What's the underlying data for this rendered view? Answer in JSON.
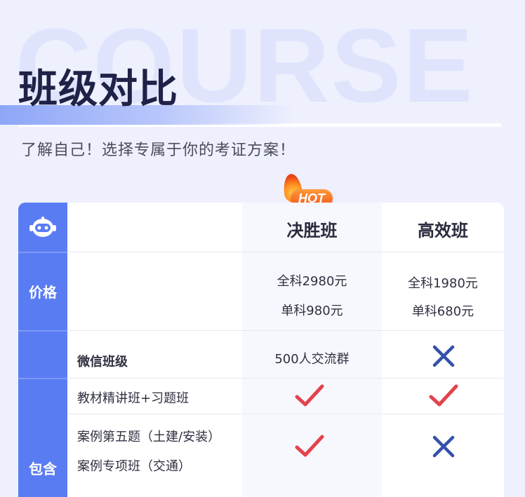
{
  "header": {
    "bg_word": "COURSE",
    "title": "班级对比",
    "subtitle": "了解自己！选择专属于你的考证方案！"
  },
  "badge": {
    "hot_label": "HOT",
    "icon": "flame-icon"
  },
  "table": {
    "columns": {
      "plan_a": "决胜班",
      "plan_b": "高效班"
    },
    "price": {
      "label": "价格",
      "plan_a": [
        "全科2980元",
        "单科980元"
      ],
      "plan_b": [
        "全科1980元",
        "单科680元"
      ]
    },
    "included": {
      "label": "包含",
      "rows": [
        {
          "feature": "微信班级",
          "plan_a": "500人交流群",
          "plan_b_icon": "cross-icon"
        },
        {
          "feature": "教材精讲班+习题班",
          "plan_a_icon": "check-icon",
          "plan_b_icon": "check-icon"
        },
        {
          "feature": "案例第五题（土建/安装）",
          "feature2": "案例专项班（交通）",
          "plan_a_icon": "check-icon",
          "plan_b_icon": "cross-icon"
        }
      ]
    }
  },
  "colors": {
    "background": "#eef0fd",
    "accent_blue": "#5a7cf3",
    "check_red": "#e2434c",
    "cross_blue": "#3451a8",
    "title_dark": "#1f2147"
  }
}
